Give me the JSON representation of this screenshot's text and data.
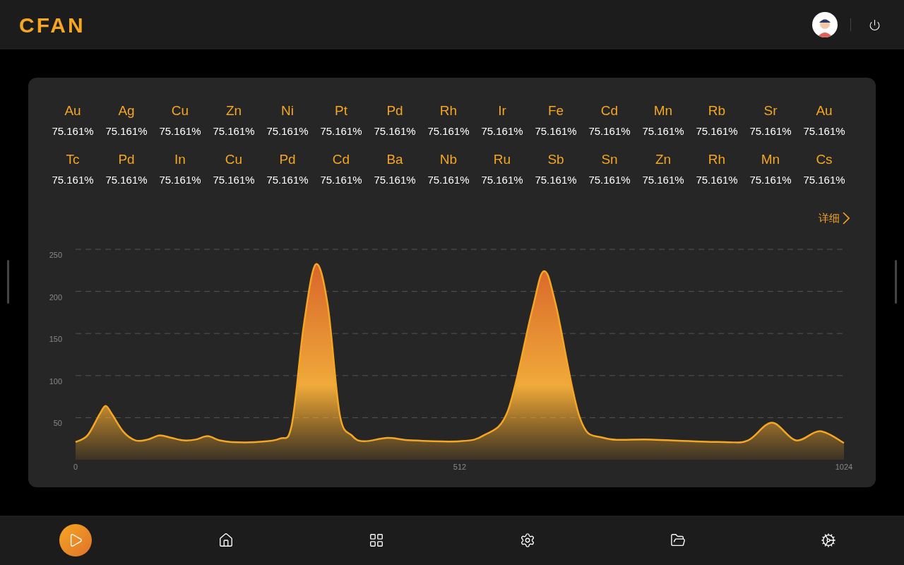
{
  "header": {
    "logo": "CFAN"
  },
  "elements": [
    {
      "symbol": "Au",
      "value": "75.161%"
    },
    {
      "symbol": "Ag",
      "value": "75.161%"
    },
    {
      "symbol": "Cu",
      "value": "75.161%"
    },
    {
      "symbol": "Zn",
      "value": "75.161%"
    },
    {
      "symbol": "Ni",
      "value": "75.161%"
    },
    {
      "symbol": "Pt",
      "value": "75.161%"
    },
    {
      "symbol": "Pd",
      "value": "75.161%"
    },
    {
      "symbol": "Rh",
      "value": "75.161%"
    },
    {
      "symbol": "Ir",
      "value": "75.161%"
    },
    {
      "symbol": "Fe",
      "value": "75.161%"
    },
    {
      "symbol": "Cd",
      "value": "75.161%"
    },
    {
      "symbol": "Mn",
      "value": "75.161%"
    },
    {
      "symbol": "Rb",
      "value": "75.161%"
    },
    {
      "symbol": "Sr",
      "value": "75.161%"
    },
    {
      "symbol": "Au",
      "value": "75.161%"
    },
    {
      "symbol": "Tc",
      "value": "75.161%"
    },
    {
      "symbol": "Pd",
      "value": "75.161%"
    },
    {
      "symbol": "In",
      "value": "75.161%"
    },
    {
      "symbol": "Cu",
      "value": "75.161%"
    },
    {
      "symbol": "Pd",
      "value": "75.161%"
    },
    {
      "symbol": "Cd",
      "value": "75.161%"
    },
    {
      "symbol": "Ba",
      "value": "75.161%"
    },
    {
      "symbol": "Nb",
      "value": "75.161%"
    },
    {
      "symbol": "Ru",
      "value": "75.161%"
    },
    {
      "symbol": "Sb",
      "value": "75.161%"
    },
    {
      "symbol": "Sn",
      "value": "75.161%"
    },
    {
      "symbol": "Zn",
      "value": "75.161%"
    },
    {
      "symbol": "Rh",
      "value": "75.161%"
    },
    {
      "symbol": "Mn",
      "value": "75.161%"
    },
    {
      "symbol": "Cs",
      "value": "75.161%"
    }
  ],
  "details_link": "详细",
  "chart_data": {
    "type": "area",
    "x": [
      0,
      16,
      32,
      40,
      48,
      64,
      80,
      96,
      112,
      128,
      144,
      160,
      176,
      192,
      208,
      240,
      272,
      288,
      304,
      320,
      336,
      352,
      368,
      384,
      416,
      448,
      512,
      544,
      576,
      608,
      624,
      640,
      672,
      704,
      768,
      864,
      896,
      928,
      960,
      992,
      1024
    ],
    "series": [
      {
        "color": "#f5a623",
        "values": [
          21,
          29,
          54,
          64,
          55,
          33,
          23,
          24,
          29,
          26,
          23,
          24,
          28,
          23,
          21,
          21,
          25,
          41,
          159,
          232,
          184,
          54,
          29,
          22,
          26,
          23,
          22,
          29,
          58,
          176,
          224,
          184,
          50,
          26,
          24,
          21,
          23,
          44,
          23,
          34,
          20
        ]
      }
    ],
    "xlim": [
      0,
      1024
    ],
    "ylim": [
      0,
      250
    ],
    "grid": true,
    "xticks": [
      0,
      512,
      1024
    ],
    "yticks": [
      50,
      100,
      150,
      200,
      250
    ]
  },
  "nav": [
    {
      "kind": "play",
      "selected": true
    },
    {
      "kind": "home",
      "selected": false
    },
    {
      "kind": "apps",
      "selected": false
    },
    {
      "kind": "settings",
      "selected": false
    },
    {
      "kind": "folder",
      "selected": false
    },
    {
      "kind": "gears",
      "selected": false
    }
  ]
}
